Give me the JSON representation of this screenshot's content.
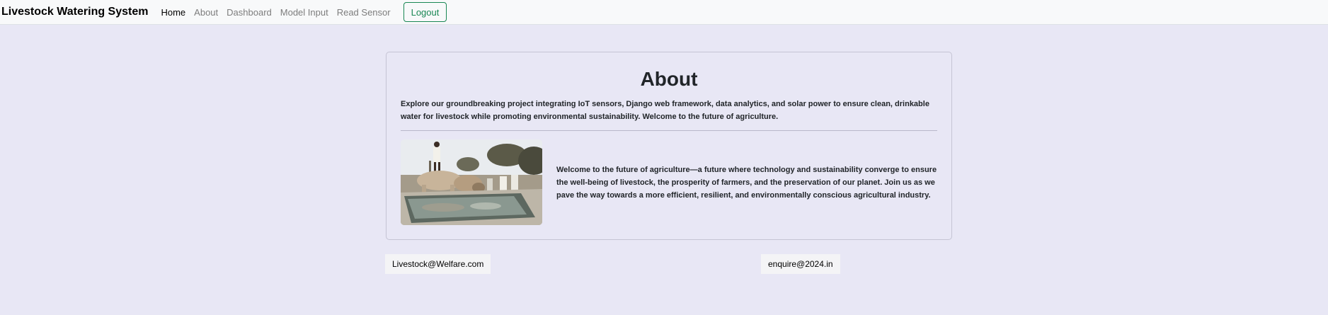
{
  "navbar": {
    "brand": "Livestock Watering System",
    "links": [
      {
        "label": "Home",
        "active": true
      },
      {
        "label": "About",
        "active": false
      },
      {
        "label": "Dashboard",
        "active": false
      },
      {
        "label": "Model Input",
        "active": false
      },
      {
        "label": "Read Sensor",
        "active": false
      }
    ],
    "logout_label": "Logout"
  },
  "about": {
    "title": "About",
    "intro": "Explore our groundbreaking project integrating IoT sensors, Django web framework, data analytics, and solar power to ensure clean, drinkable water for livestock while promoting environmental sustainability. Welcome to the future of agriculture.",
    "image_alt": "cattle drinking at a water trough",
    "body": "Welcome to the future of agriculture—a future where technology and sustainability converge to ensure the well-being of livestock, the prosperity of farmers, and the preservation of our planet. Join us as we pave the way towards a more efficient, resilient, and environmentally conscious agricultural industry."
  },
  "footer": {
    "email_left": "Livestock@Welfare.com",
    "email_right": "enquire@2024.in"
  },
  "colors": {
    "page_background": "#e8e7f5",
    "navbar_background": "#f8f9fa",
    "logout_accent": "#198754"
  }
}
